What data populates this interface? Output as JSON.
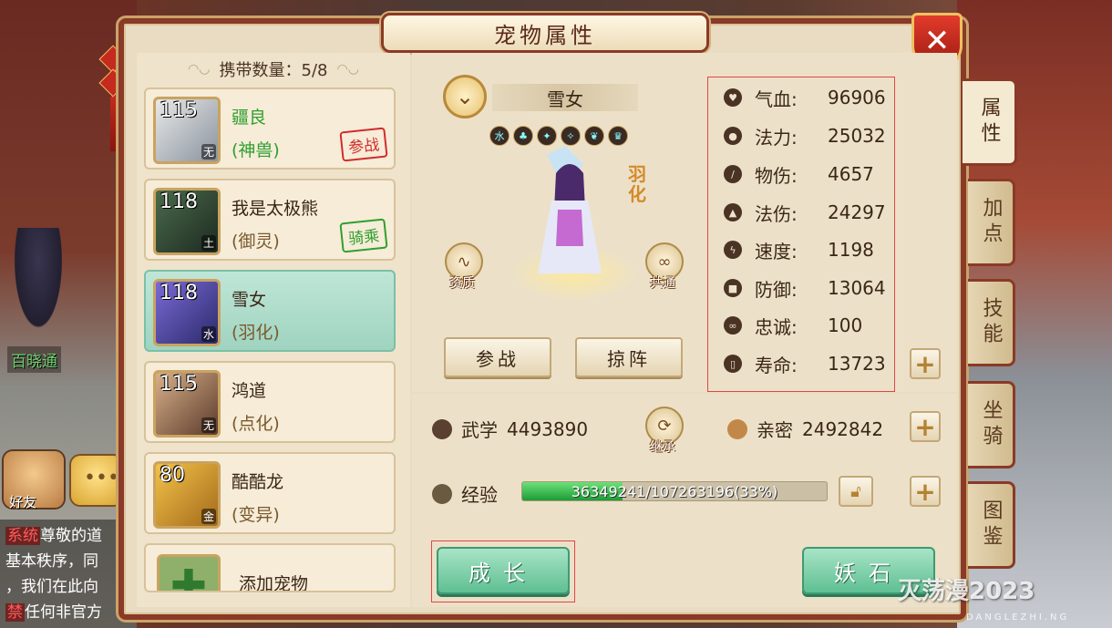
{
  "window": {
    "title": "宠物属性"
  },
  "scene": {
    "npc_name": "百晓通",
    "friend_label": "好友",
    "chat_lines": [
      {
        "tag": "系统",
        "text": "尊敬的道"
      },
      {
        "tag": "",
        "text": "基本秩序，同"
      },
      {
        "tag": "",
        "text": "，我们在此向"
      },
      {
        "tag": "禁",
        "text": "任何非官方"
      }
    ]
  },
  "left": {
    "carry_label": "携带数量：",
    "carry_value": "5/8",
    "pets": [
      {
        "level": "115",
        "element": "无",
        "name": "疆良",
        "type": "(神兽)",
        "badge": "参战",
        "badge_color": "red",
        "highlight": true
      },
      {
        "level": "118",
        "element": "土",
        "name": "我是太极熊",
        "type": "(御灵)",
        "badge": "骑乘",
        "badge_color": "green",
        "highlight": false
      },
      {
        "level": "118",
        "element": "水",
        "name": "雪女",
        "type": "(羽化)",
        "badge": "",
        "badge_color": "",
        "highlight": false
      },
      {
        "level": "115",
        "element": "无",
        "name": "鸿道",
        "type": "(点化)",
        "badge": "",
        "badge_color": "",
        "highlight": false
      },
      {
        "level": "80",
        "element": "金",
        "name": "酷酷龙",
        "type": "(变异)",
        "badge": "",
        "badge_color": "",
        "highlight": false
      }
    ],
    "add_pet_label": "添加宠物"
  },
  "pet": {
    "name": "雪女",
    "skill_icons": [
      "水",
      "♣",
      "✦",
      "✧",
      "❦",
      "♛"
    ],
    "yuhua": "羽化",
    "aptitude_label": "资质",
    "share_label": "共通",
    "fight_button": "参战",
    "formation_button": "掠阵"
  },
  "stats": [
    {
      "icon": "heart-icon",
      "label": "气血:",
      "value": "96906"
    },
    {
      "icon": "drop-icon",
      "label": "法力:",
      "value": "25032"
    },
    {
      "icon": "sword-icon",
      "label": "物伤:",
      "value": "4657"
    },
    {
      "icon": "flame-icon",
      "label": "法伤:",
      "value": "24297"
    },
    {
      "icon": "bolt-icon",
      "label": "速度:",
      "value": "1198"
    },
    {
      "icon": "shield-icon",
      "label": "防御:",
      "value": "13064"
    },
    {
      "icon": "bond-icon",
      "label": "忠诚:",
      "value": "100"
    },
    {
      "icon": "life-icon",
      "label": "寿命:",
      "value": "13723"
    }
  ],
  "lower": {
    "martial_label": "武学",
    "martial_value": "4493890",
    "inherit_label": "继承",
    "intimacy_label": "亲密",
    "intimacy_value": "2492842",
    "exp_label": "经验",
    "exp_text": "36349241/107263196(33%)",
    "exp_fraction": 0.33,
    "grow_button": "成长",
    "stone_button": "妖石"
  },
  "tabs": [
    "属性",
    "加点",
    "技能",
    "坐骑",
    "图鉴"
  ],
  "watermark": {
    "main": "灭荡漫2023",
    "sub": "DANGLEZHI.NG"
  },
  "colors": {
    "accent_red": "#8a3a26",
    "green_btn": "#5fbf93",
    "exp_green": "#1c9c35"
  }
}
